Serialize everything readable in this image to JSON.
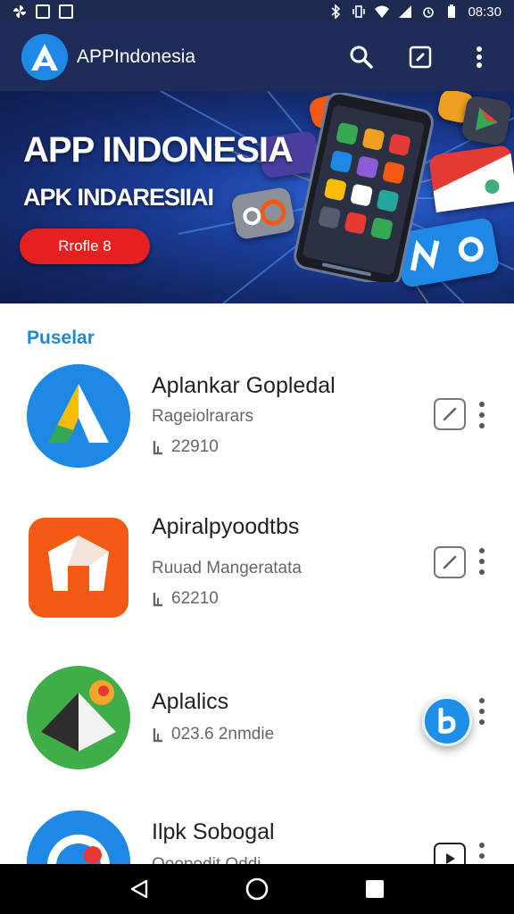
{
  "status_bar": {
    "time": "08:30",
    "icons_left": [
      "pinwheel-icon",
      "image-icon",
      "square-icon"
    ],
    "icons_right": [
      "bluetooth-icon",
      "vibrate-icon",
      "wifi-icon",
      "signal-icon",
      "alarm-icon",
      "battery-icon"
    ]
  },
  "appbar": {
    "title": "APPIndonesia",
    "actions": [
      "search-icon",
      "edit-icon",
      "more-icon"
    ]
  },
  "banner": {
    "headline": "APP INDONESIA",
    "subheadline": "APK INDARESIIAI",
    "button_label": "Rrofle 8"
  },
  "section": {
    "title": "Puselar"
  },
  "apps": [
    {
      "name": "Aplankar Gopledal",
      "category": "Rageiolrarars",
      "count": "22910",
      "action": "edit",
      "icon_colors": [
        "#1e88e5",
        "#fbbc05",
        "#34a853"
      ]
    },
    {
      "name": "Apiralpyoodtbs",
      "category": "Ruuad Mangeratata",
      "count": "62210",
      "action": "edit",
      "icon_colors": [
        "#f25a14",
        "#ffffff"
      ]
    },
    {
      "name": "Aplalics",
      "category": "",
      "count": "023.6 2nmdie",
      "action": "fab",
      "icon_colors": [
        "#3fae49",
        "#2d2d2d",
        "#f4a52a"
      ]
    },
    {
      "name": "Ilpk Sobogal",
      "category": "Ooopodit Oddi",
      "count": "",
      "action": "play",
      "icon_colors": [
        "#1e88e5",
        "#ffffff",
        "#e53935"
      ]
    }
  ],
  "navbar": {
    "buttons": [
      "back-icon",
      "home-icon",
      "recents-icon"
    ]
  }
}
